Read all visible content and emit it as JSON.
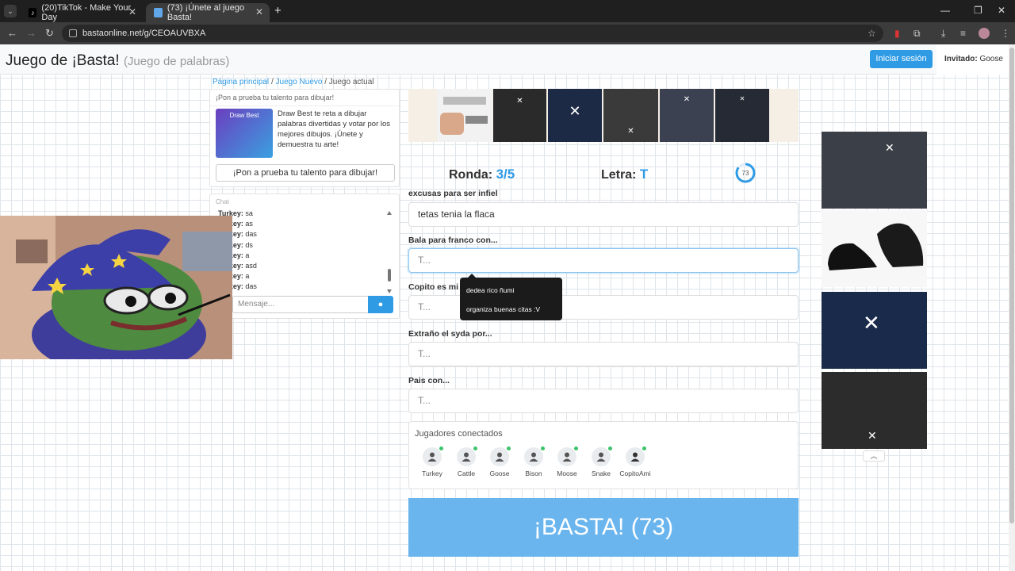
{
  "browser": {
    "tabs": [
      {
        "title": "(20)TikTok - Make Your Day",
        "active": false
      },
      {
        "title": "(73) ¡Únete al juego Basta!",
        "active": true
      }
    ],
    "url": "bastaonline.net/g/CEOAUVBXA"
  },
  "header": {
    "title": "Juego de ¡Basta!",
    "subtitle": "(Juego de palabras)",
    "login_label": "Iniciar sesión",
    "guest_label": "Invitado:",
    "guest_name": "Goose"
  },
  "breadcrumb": {
    "home": "Página principal",
    "new_game": "Juego Nuevo",
    "current": "Juego actual"
  },
  "draw_promo": {
    "heading": "¡Pon a prueba tu talento para dibujar!",
    "image_text": "Draw Best",
    "text": "Draw Best te reta a dibujar palabras divertidas y votar por los mejores dibujos. ¡Únete y demuestra tu arte!",
    "button": "¡Pon a prueba tu talento para dibujar!"
  },
  "chat": {
    "heading": "Chat",
    "messages": [
      {
        "user": "Turkey:",
        "text": "sa"
      },
      {
        "user": "Turkey:",
        "text": "as"
      },
      {
        "user": "Turkey:",
        "text": "das"
      },
      {
        "user": "Turkey:",
        "text": "ds"
      },
      {
        "user": "Turkey:",
        "text": "a"
      },
      {
        "user": "Turkey:",
        "text": "asd"
      },
      {
        "user": "Turkey:",
        "text": "a"
      },
      {
        "user": "Turkey:",
        "text": "das"
      }
    ],
    "input_placeholder": "Mensaje..."
  },
  "game": {
    "round_label": "Ronda:",
    "round_value": "3/5",
    "letter_label": "Letra:",
    "letter_value": "T",
    "timer": "73",
    "timer_fraction": 0.85,
    "categories": [
      {
        "label": "excusas para ser infiel",
        "value": "tetas tenia la flaca",
        "placeholder": "T..."
      },
      {
        "label": "Bala para franco con...",
        "value": "",
        "placeholder": "T..."
      },
      {
        "label": "Copito es mi",
        "value": "",
        "placeholder": "T..."
      },
      {
        "label": "Extraño el syda por...",
        "value": "",
        "placeholder": "T..."
      },
      {
        "label": "Pais con...",
        "value": "",
        "placeholder": "T..."
      }
    ],
    "tooltip": [
      "dedea rico ñumi",
      "organiza buenas citas :V"
    ],
    "players_heading": "Jugadores conectados",
    "players": [
      "Turkey",
      "Cattle",
      "Goose",
      "Bison",
      "Moose",
      "Snake",
      "CopitoAmi"
    ],
    "basta_button": "¡BASTA! (73)"
  },
  "colors": {
    "accent": "#2f9be5",
    "basta": "#6ab5ee",
    "online": "#3cc46a"
  }
}
